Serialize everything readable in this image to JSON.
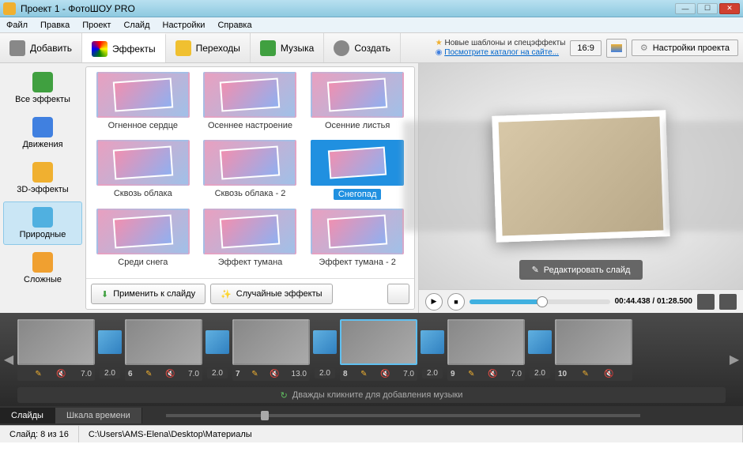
{
  "window": {
    "title": "Проект 1 - ФотоШОУ PRO"
  },
  "menubar": [
    "Файл",
    "Правка",
    "Проект",
    "Слайд",
    "Настройки",
    "Справка"
  ],
  "toolbar": {
    "add": "Добавить",
    "effects": "Эффекты",
    "transitions": "Переходы",
    "music": "Музыка",
    "create": "Создать",
    "info1": "Новые шаблоны и спецэффекты",
    "info2": "Посмотрите каталог на сайте...",
    "ratio": "16:9",
    "project_settings": "Настройки проекта"
  },
  "categories": [
    {
      "label": "Все эффекты",
      "color": "#40a040"
    },
    {
      "label": "Движения",
      "color": "#4080e0"
    },
    {
      "label": "3D-эффекты",
      "color": "#f0b030"
    },
    {
      "label": "Природные",
      "color": "#50b0e0"
    },
    {
      "label": "Сложные",
      "color": "#f0a030"
    }
  ],
  "selected_category": 3,
  "effects": [
    {
      "label": "Огненное сердце"
    },
    {
      "label": "Осеннее настроение"
    },
    {
      "label": "Осенние листья"
    },
    {
      "label": "Сквозь облака"
    },
    {
      "label": "Сквозь облака - 2"
    },
    {
      "label": "Снегопад"
    },
    {
      "label": "Среди снега"
    },
    {
      "label": "Эффект тумана"
    },
    {
      "label": "Эффект тумана - 2"
    }
  ],
  "selected_effect": 5,
  "effects_footer": {
    "apply": "Применить к слайду",
    "random": "Случайные эффекты"
  },
  "preview": {
    "edit_btn": "Редактировать слайд"
  },
  "player": {
    "time": "00:44.438 / 01:28.500"
  },
  "timeline": {
    "slides": [
      {
        "num": "",
        "dur": "7.0",
        "trans": "2.0"
      },
      {
        "num": "6",
        "dur": "7.0",
        "trans": "2.0"
      },
      {
        "num": "7",
        "dur": "13.0",
        "trans": "2.0"
      },
      {
        "num": "8",
        "dur": "7.0",
        "trans": "2.0"
      },
      {
        "num": "9",
        "dur": "7.0",
        "trans": "2.0"
      },
      {
        "num": "10",
        "dur": "",
        "trans": ""
      }
    ],
    "selected": 3,
    "music_hint": "Дважды кликните для добавления музыки"
  },
  "bottom_tabs": {
    "slides": "Слайды",
    "timeline": "Шкала времени"
  },
  "statusbar": {
    "slide": "Слайд: 8 из 16",
    "path": "C:\\Users\\AMS-Elena\\Desktop\\Материалы"
  }
}
